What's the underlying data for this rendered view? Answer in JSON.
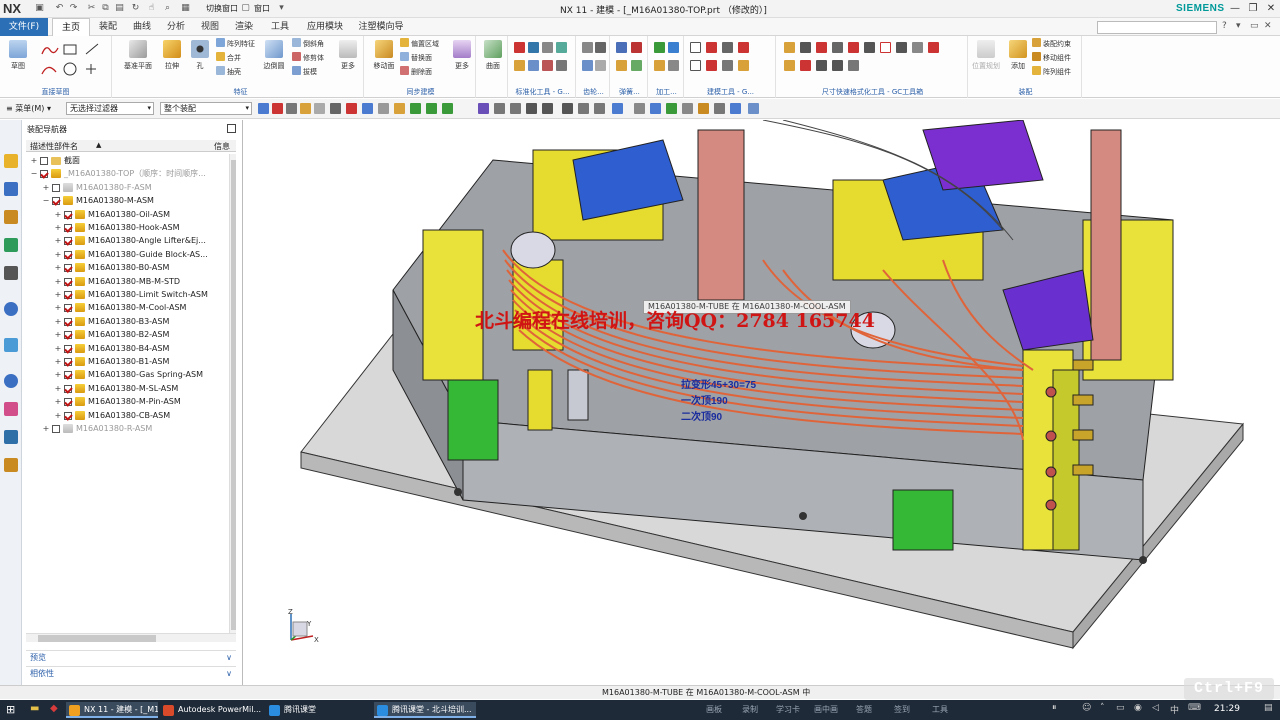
{
  "app": {
    "logo": "NX",
    "window_title": "NX 11 - 建模 - [_M16A01380-TOP.prt （修改的）]",
    "brand": "SIEMENS"
  },
  "ribbon_tabs": [
    "文件(F)",
    "主页",
    "装配",
    "曲线",
    "分析",
    "视图",
    "渲染",
    "工具",
    "应用模块",
    "注塑模向导"
  ],
  "active_tab": "主页",
  "quick_access": {
    "switch_window": "切换窗口",
    "window": "窗口"
  },
  "ribbon": {
    "sketch_group": {
      "label": "直接草图",
      "sketch_button": "草图"
    },
    "feature_group": {
      "label": "特征",
      "datum_plane": "基准平面",
      "extrude": "拉伸",
      "hole": "孔",
      "pattern_feature": "阵列特征",
      "unite": "合并",
      "shell": "抽壳",
      "edge_blend": "边倒圆",
      "chamfer": "倒斜角",
      "trim_body": "修剪体",
      "draft": "拔模",
      "more": "更多"
    },
    "sync_group": {
      "label": "同步建模",
      "move_face": "移动面",
      "offset_region": "偏置区域",
      "replace_face": "替换面",
      "delete_face": "删除面",
      "more": "更多"
    },
    "surface_group": {
      "surface": "曲面"
    },
    "std_tools_label": "标准化工具 - G...",
    "gear_label": "齿轮...",
    "spring_label": "弹簧...",
    "process_label": "加工...",
    "build_tools_label": "建模工具 - G...",
    "dims_label": "尺寸快速格式化工具 - GC工具箱",
    "assembly_group": {
      "label": "装配",
      "add": "添加",
      "assembly_constraints": "装配约束",
      "move_component": "移动组件",
      "pattern_component": "阵列组件",
      "disabled_button": "位置规划"
    }
  },
  "selection_bar": {
    "menu": "菜单(M)",
    "filter": "无选择过滤器",
    "scope": "整个装配"
  },
  "navigator": {
    "title": "装配导航器",
    "columns": {
      "name": "描述性部件名",
      "info": "信息"
    },
    "tree": [
      {
        "label": "截面",
        "indent": 0,
        "expander": "+",
        "checkbox": false,
        "icon": "folder",
        "dim": false
      },
      {
        "label": "_M16A01380-TOP（顺序：时间顺序...",
        "indent": 0,
        "expander": "−",
        "checkbox": true,
        "icon": "asm",
        "dim": true
      },
      {
        "label": "M16A01380-F-ASM",
        "indent": 1,
        "expander": "+",
        "checkbox": false,
        "icon": "asm-gray",
        "dim": true
      },
      {
        "label": "M16A01380-M-ASM",
        "indent": 1,
        "expander": "−",
        "checkbox": true,
        "icon": "asm",
        "dim": false
      },
      {
        "label": "M16A01380-Oil-ASM",
        "indent": 2,
        "expander": "+",
        "checkbox": true,
        "icon": "asm",
        "dim": false
      },
      {
        "label": "M16A01380-Hook-ASM",
        "indent": 2,
        "expander": "+",
        "checkbox": true,
        "icon": "asm",
        "dim": false
      },
      {
        "label": "M16A01380-Angle Lifter&Ej...",
        "indent": 2,
        "expander": "+",
        "checkbox": true,
        "icon": "asm",
        "dim": false
      },
      {
        "label": "M16A01380-Guide Block-AS...",
        "indent": 2,
        "expander": "+",
        "checkbox": true,
        "icon": "asm",
        "dim": false
      },
      {
        "label": "M16A01380-B0-ASM",
        "indent": 2,
        "expander": "+",
        "checkbox": true,
        "icon": "asm",
        "dim": false
      },
      {
        "label": "M16A01380-MB-M-STD",
        "indent": 2,
        "expander": "+",
        "checkbox": true,
        "icon": "asm",
        "dim": false
      },
      {
        "label": "M16A01380-Limit Switch-ASM",
        "indent": 2,
        "expander": "+",
        "checkbox": true,
        "icon": "asm",
        "dim": false
      },
      {
        "label": "M16A01380-M-Cool-ASM",
        "indent": 2,
        "expander": "+",
        "checkbox": true,
        "icon": "asm",
        "dim": false
      },
      {
        "label": "M16A01380-B3-ASM",
        "indent": 2,
        "expander": "+",
        "checkbox": true,
        "icon": "asm",
        "dim": false
      },
      {
        "label": "M16A01380-B2-ASM",
        "indent": 2,
        "expander": "+",
        "checkbox": true,
        "icon": "asm",
        "dim": false
      },
      {
        "label": "M16A01380-B4-ASM",
        "indent": 2,
        "expander": "+",
        "checkbox": true,
        "icon": "asm",
        "dim": false
      },
      {
        "label": "M16A01380-B1-ASM",
        "indent": 2,
        "expander": "+",
        "checkbox": true,
        "icon": "asm",
        "dim": false
      },
      {
        "label": "M16A01380-Gas Spring-ASM",
        "indent": 2,
        "expander": "+",
        "checkbox": true,
        "icon": "asm",
        "dim": false
      },
      {
        "label": "M16A01380-M-SL-ASM",
        "indent": 2,
        "expander": "+",
        "checkbox": true,
        "icon": "asm",
        "dim": false
      },
      {
        "label": "M16A01380-M-Pin-ASM",
        "indent": 2,
        "expander": "+",
        "checkbox": true,
        "icon": "asm",
        "dim": false
      },
      {
        "label": "M16A01380-CB-ASM",
        "indent": 2,
        "expander": "+",
        "checkbox": true,
        "icon": "asm",
        "dim": false
      },
      {
        "label": "M16A01380-R-ASM",
        "indent": 1,
        "expander": "+",
        "checkbox": false,
        "icon": "asm-gray",
        "dim": true
      }
    ],
    "panels": {
      "preview": "预览",
      "dependencies": "相依性"
    }
  },
  "viewport": {
    "tooltip": "M16A01380-M-TUBE 在 M16A01380-M-COOL-ASM",
    "watermark": "北斗编程在线培训，咨询QQ：2784 165744",
    "annotations": [
      "拉变形45+30=75",
      "一次顶190",
      "二次顶90"
    ],
    "triad": {
      "x": "X",
      "y": "Y",
      "z": "Z"
    }
  },
  "status": {
    "message": "M16A01380-M-TUBE 在 M16A01380-M-COOL-ASM 中",
    "key_hint": "Ctrl+F9"
  },
  "taskbar": {
    "tasks": [
      {
        "label": "NX 11 - 建模 - [_M1..."
      },
      {
        "label": "Autodesk PowerMil..."
      },
      {
        "label": "腾讯课堂"
      },
      {
        "label": "腾讯课堂 - 北斗培训..."
      }
    ],
    "tray_items": [
      "画板",
      "录制",
      "学习卡",
      "画中画",
      "答题",
      "签到",
      "工具"
    ],
    "clock": "21:29"
  },
  "colors": {
    "accent": "#2b6fb6",
    "link": "#2a5ea8",
    "watermark": "#d01414",
    "annotation": "#1a2d9e",
    "brand": "#009999"
  }
}
